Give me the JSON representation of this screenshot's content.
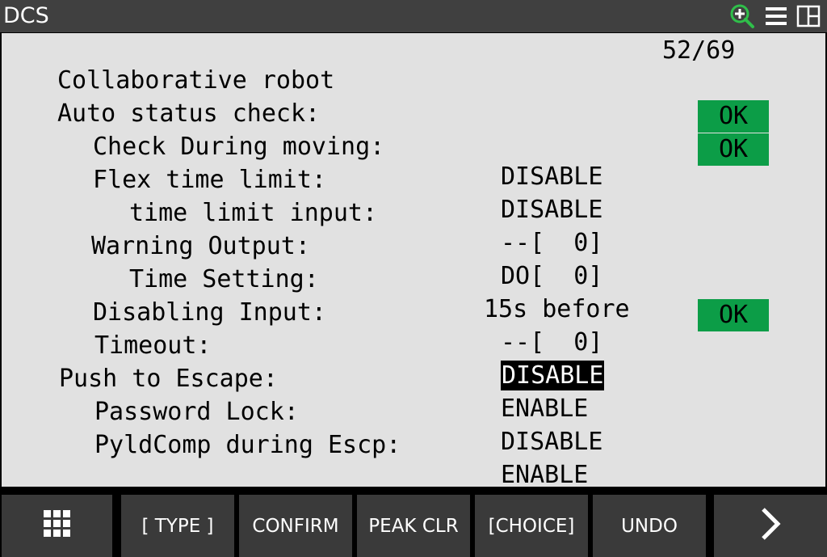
{
  "window": {
    "title": "DCS"
  },
  "header_icons": {
    "zoom": "zoom-in-icon",
    "menu": "hamburger-menu-icon",
    "window": "window-split-icon"
  },
  "screen": {
    "heading": "Collaborative robot",
    "page_counter": "52/69",
    "rows": [
      {
        "label": "Auto status check:",
        "value": "",
        "ok": ""
      },
      {
        "label": "Check During moving:",
        "value": "DISABLE",
        "ok": "OK"
      },
      {
        "label": "Flex time limit:",
        "value": "DISABLE",
        "ok": "OK"
      },
      {
        "label": "time limit input:",
        "value": "--[  0]",
        "ok": ""
      },
      {
        "label": "Warning Output:",
        "value": "DO[  0]",
        "ok": ""
      },
      {
        "label": "Time Setting:",
        "value": "15s before",
        "ok": ""
      },
      {
        "label": "Disabling Input:",
        "value": "--[  0]",
        "ok": ""
      },
      {
        "label": "Timeout:",
        "value": "DISABLE",
        "ok": "OK"
      },
      {
        "label": "Push to Escape:",
        "value": "ENABLE",
        "ok": ""
      },
      {
        "label": "Password Lock:",
        "value": "DISABLE",
        "ok": ""
      },
      {
        "label": "PyldComp during Escp:",
        "value": "ENABLE",
        "ok": ""
      }
    ],
    "selected_value": "Timeout: DISABLE"
  },
  "function_keys": {
    "f1": "[ TYPE ]",
    "f2": "CONFIRM",
    "f3": "PEAK CLR",
    "f4": "[CHOICE]",
    "f5": "UNDO",
    "apps_icon": "grid-apps-icon",
    "next_icon": "chevron-right-icon"
  },
  "colors": {
    "ok_green": "#0c9d47",
    "titlebar": "#404040",
    "background": "#e1e1e1",
    "key_bg": "#3a3a3a"
  }
}
